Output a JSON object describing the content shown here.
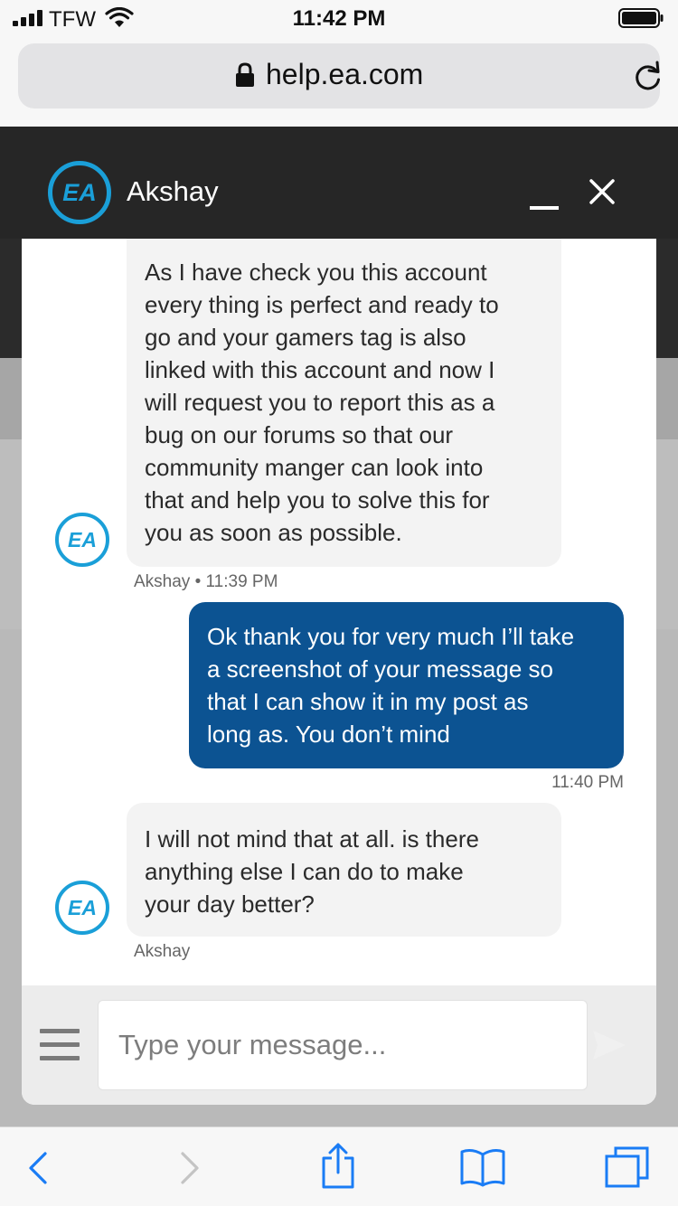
{
  "status_bar": {
    "carrier": "TFW",
    "time": "11:42 PM",
    "signal_icon": "signal-bars-icon",
    "wifi_icon": "wifi-icon",
    "battery_icon": "battery-icon"
  },
  "browser": {
    "url": "help.ea.com",
    "lock_icon": "lock-icon",
    "reload_icon": "reload-icon"
  },
  "chat": {
    "agent_name": "Akshay",
    "accent_color": "#0c5392",
    "logo_color": "#1a9fd8",
    "messages": [
      {
        "sender": "agent",
        "lines": [
          "As I have check you this account",
          "every thing is perfect and ready to",
          "go and your gamers tag is also",
          "linked with this account and now I",
          "will request you to report this as a",
          "bug on our forums so that our",
          "community manger can look into",
          "that and help you to solve this for",
          "you as soon as possible."
        ],
        "meta": "Akshay • 11:39 PM"
      },
      {
        "sender": "user",
        "lines": [
          "Ok thank you for very much I’ll take",
          "a screenshot of your message so",
          "that I can show it in my post as",
          "long as. You don’t mind"
        ],
        "meta": "11:40 PM"
      },
      {
        "sender": "agent",
        "lines": [
          "I will not mind that at all. is there",
          "anything else I can do to make",
          "your day better?"
        ],
        "meta": "Akshay"
      }
    ],
    "input_placeholder": "Type your message..."
  },
  "toolbar": {
    "icons": [
      "back-icon",
      "forward-icon",
      "share-icon",
      "bookmarks-icon",
      "tabs-icon"
    ]
  }
}
